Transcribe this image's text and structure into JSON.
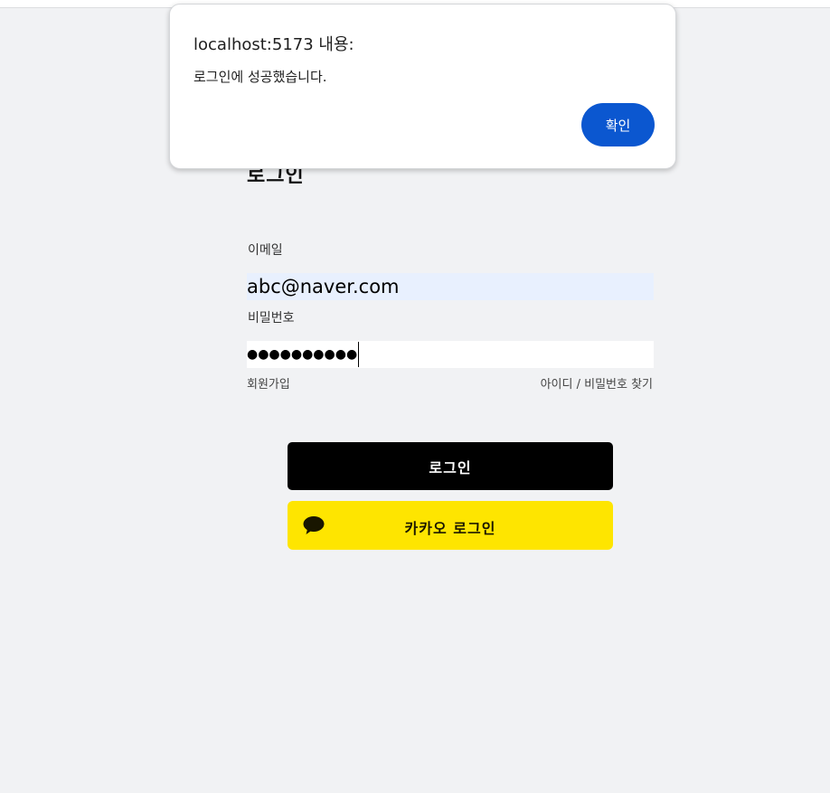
{
  "dialog": {
    "origin": "localhost:5173 내용:",
    "message": "로그인에 성공했습니다.",
    "ok_label": "확인",
    "ok_color": "#0b57d0"
  },
  "login": {
    "title": "로그인",
    "email_label": "이메일",
    "email_value": "abc@naver.com",
    "password_label": "비밀번호",
    "password_masked": "●●●●●●●●●●",
    "signup_label": "회원가입",
    "find_label": "아이디 / 비밀번호 찾기",
    "login_button_label": "로그인",
    "kakao_button_label": "카카오 로그인",
    "kakao_icon": "speech-bubble-icon",
    "kakao_color": "#fee500"
  }
}
